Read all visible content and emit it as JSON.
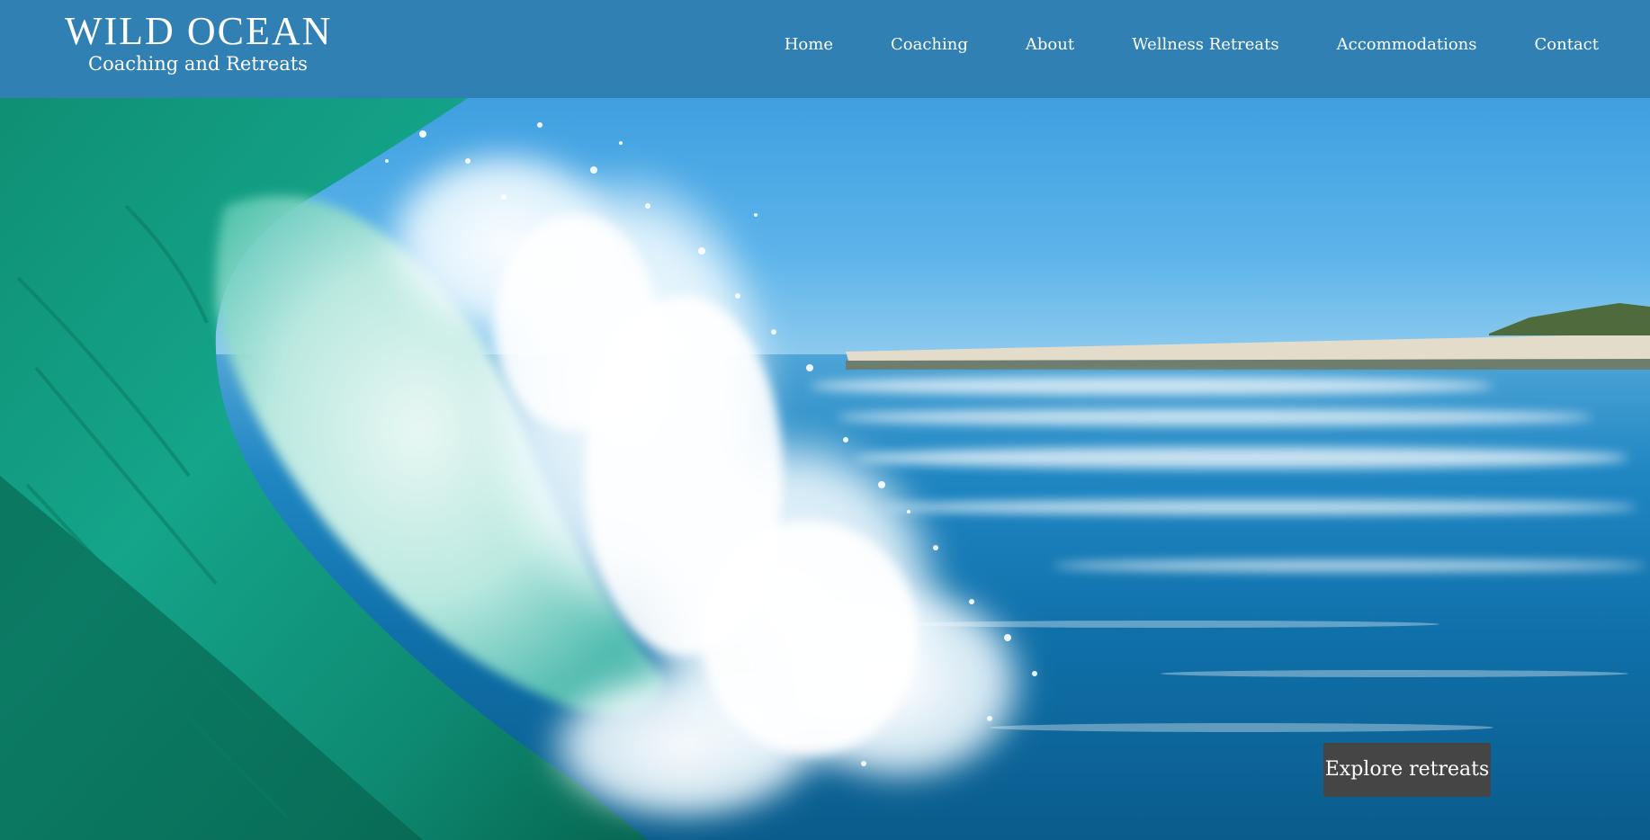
{
  "brand": {
    "name": "WILD OCEAN",
    "tagline": "Coaching and Retreats"
  },
  "nav": {
    "items": [
      {
        "label": "Home"
      },
      {
        "label": "Coaching"
      },
      {
        "label": "About"
      },
      {
        "label": "Wellness Retreats"
      },
      {
        "label": "Accommodations"
      },
      {
        "label": "Contact"
      }
    ]
  },
  "hero": {
    "image": "ocean-wave-photo",
    "cta_label": "Explore retreats"
  },
  "colors": {
    "header_bg": "#3180b4",
    "cta_bg": "#454545",
    "text": "#ffffff"
  }
}
